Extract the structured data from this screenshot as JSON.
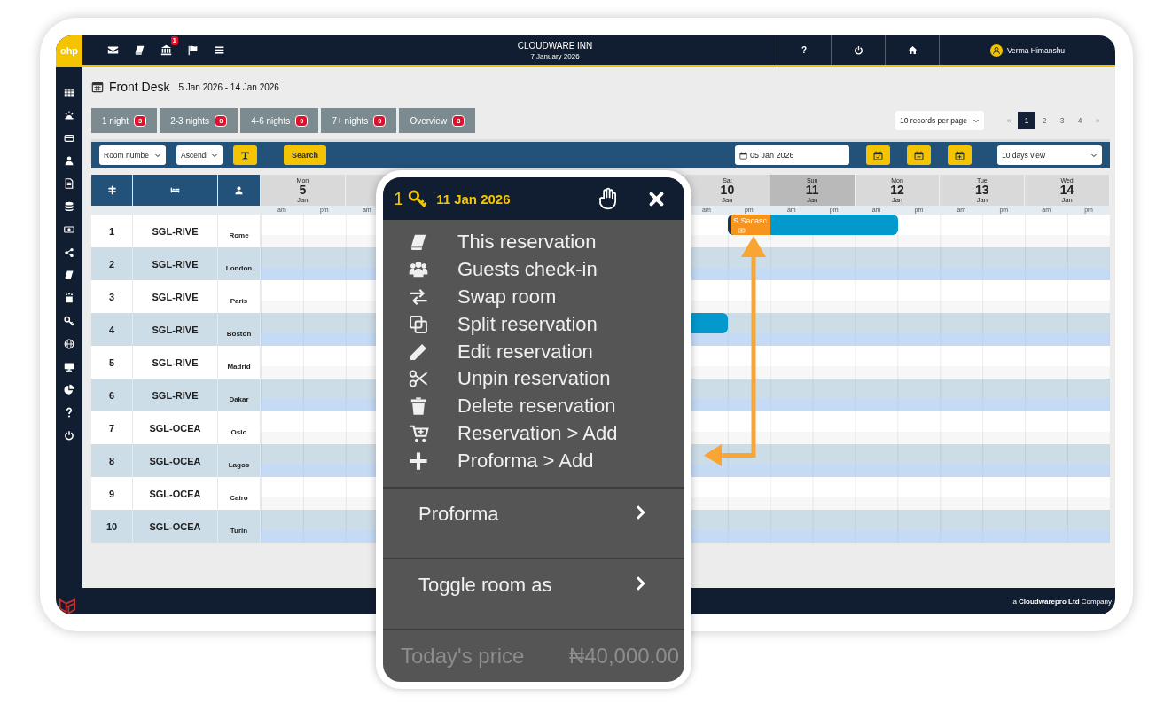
{
  "app": {
    "logo": "ohp",
    "notification_count": "1",
    "hotel": "CLOUDWARE INN",
    "date": "7 January 2026",
    "help": "?",
    "user": "Verma Himanshu"
  },
  "page": {
    "title": "Front Desk",
    "range": "5 Jan 2026 - 14 Jan 2026"
  },
  "tabs": [
    {
      "label": "1 night",
      "count": "3",
      "selected": false
    },
    {
      "label": "2-3 nights",
      "count": "0",
      "selected": false
    },
    {
      "label": "4-6 nights",
      "count": "0",
      "selected": false
    },
    {
      "label": "7+ nights",
      "count": "0",
      "selected": false
    },
    {
      "label": "Overview",
      "count": "3",
      "selected": false
    }
  ],
  "records_per_page": "10 records per page",
  "pagination": {
    "prev": "«",
    "pages": [
      {
        "label": "1",
        "selected": true
      },
      {
        "label": "2",
        "selected": false
      },
      {
        "label": "3",
        "selected": false
      },
      {
        "label": "4",
        "selected": false
      }
    ],
    "next": "»"
  },
  "toolbar": {
    "sort_field": "Room numbe",
    "sort_order": "Ascendi",
    "search_button": "Search",
    "date": "05 Jan 2026",
    "view": "10 days view"
  },
  "days": [
    {
      "weekday": "Mon",
      "day": "5",
      "month": "Jan",
      "halves": [
        "am",
        "pm"
      ],
      "highlighted": false
    },
    {
      "halves": [
        "am"
      ]
    },
    {
      "weekday": "Sat",
      "day": "10",
      "month": "Jan",
      "halves": [
        "am",
        "pm"
      ],
      "highlighted": false
    },
    {
      "weekday": "Sun",
      "day": "11",
      "month": "Jan",
      "halves": [
        "am",
        "pm"
      ],
      "highlighted": true
    },
    {
      "weekday": "Mon",
      "day": "12",
      "month": "Jan",
      "halves": [
        "am",
        "pm"
      ],
      "highlighted": false
    },
    {
      "weekday": "Tue",
      "day": "13",
      "month": "Jan",
      "halves": [
        "am",
        "pm"
      ],
      "highlighted": false
    },
    {
      "weekday": "Wed",
      "day": "14",
      "month": "Jan",
      "halves": [
        "am",
        "pm"
      ],
      "highlighted": false
    }
  ],
  "rooms": [
    {
      "number": "1",
      "room": "SGL-RIVE",
      "guest": "Rome",
      "days": [
        {
          "am": {
            "booked": false
          },
          "pm": {
            "booked": false
          }
        },
        {
          "am": {
            "booked": false
          }
        },
        {
          "am": {
            "booked": false
          },
          "pm": {
            "booked": true,
            "label": "S Sacasc",
            "cash": true
          }
        },
        {
          "am": {
            "booked": true
          },
          "pm": {
            "booked": true
          }
        },
        {
          "am": {
            "booked": true
          },
          "pm": {
            "booked": false
          }
        },
        {
          "am": {
            "booked": false
          },
          "pm": {
            "booked": false
          }
        },
        {
          "am": {
            "booked": false
          },
          "pm": {
            "booked": false
          }
        }
      ]
    },
    {
      "number": "2",
      "room": "SGL-RIVE",
      "guest": "London"
    },
    {
      "number": "3",
      "room": "SGL-RIVE",
      "guest": "Paris"
    },
    {
      "number": "4",
      "room": "SGL-RIVE",
      "guest": "Boston",
      "days": [
        {
          "am": {
            "booked": false
          },
          "pm": {
            "booked": false
          }
        },
        {
          "am": {
            "booked": false
          }
        },
        {
          "am": {
            "booked": true
          },
          "pm": {
            "booked": false
          }
        },
        {
          "am": {
            "booked": false
          },
          "pm": {
            "booked": false
          }
        },
        {
          "am": {
            "booked": false
          },
          "pm": {
            "booked": false
          }
        },
        {
          "am": {
            "booked": false
          },
          "pm": {
            "booked": false
          }
        },
        {
          "am": {
            "booked": false
          },
          "pm": {
            "booked": false
          }
        }
      ]
    },
    {
      "number": "5",
      "room": "SGL-RIVE",
      "guest": "Madrid"
    },
    {
      "number": "6",
      "room": "SGL-RIVE",
      "guest": "Dakar"
    },
    {
      "number": "7",
      "room": "SGL-OCEA",
      "guest": "Oslo"
    },
    {
      "number": "8",
      "room": "SGL-OCEA",
      "guest": "Lagos"
    },
    {
      "number": "9",
      "room": "SGL-OCEA",
      "guest": "Cairo"
    },
    {
      "number": "10",
      "room": "SGL-OCEA",
      "guest": "Turin"
    }
  ],
  "footer": "a **Cloudwarepro Ltd** Company",
  "popup": {
    "room": "1",
    "date": "11 Jan 2026",
    "items": [
      {
        "kind": "book",
        "label": "This reservation"
      },
      {
        "kind": "guests",
        "label": "Guests check-in"
      },
      {
        "kind": "swap",
        "label": "Swap room"
      },
      {
        "kind": "split",
        "label": "Split reservation"
      },
      {
        "kind": "edit",
        "label": "Edit reservation"
      },
      {
        "kind": "unpin",
        "label": "Unpin reservation"
      },
      {
        "kind": "delete",
        "label": "Delete reservation"
      },
      {
        "kind": "cart",
        "label": "Reservation > Add"
      },
      {
        "kind": "plus",
        "label": "Proforma > Add"
      }
    ],
    "submenus": [
      {
        "label": "Proforma"
      },
      {
        "label": "Toggle room as"
      }
    ],
    "price_label": "Today's price",
    "price": "₦40,000.00"
  }
}
